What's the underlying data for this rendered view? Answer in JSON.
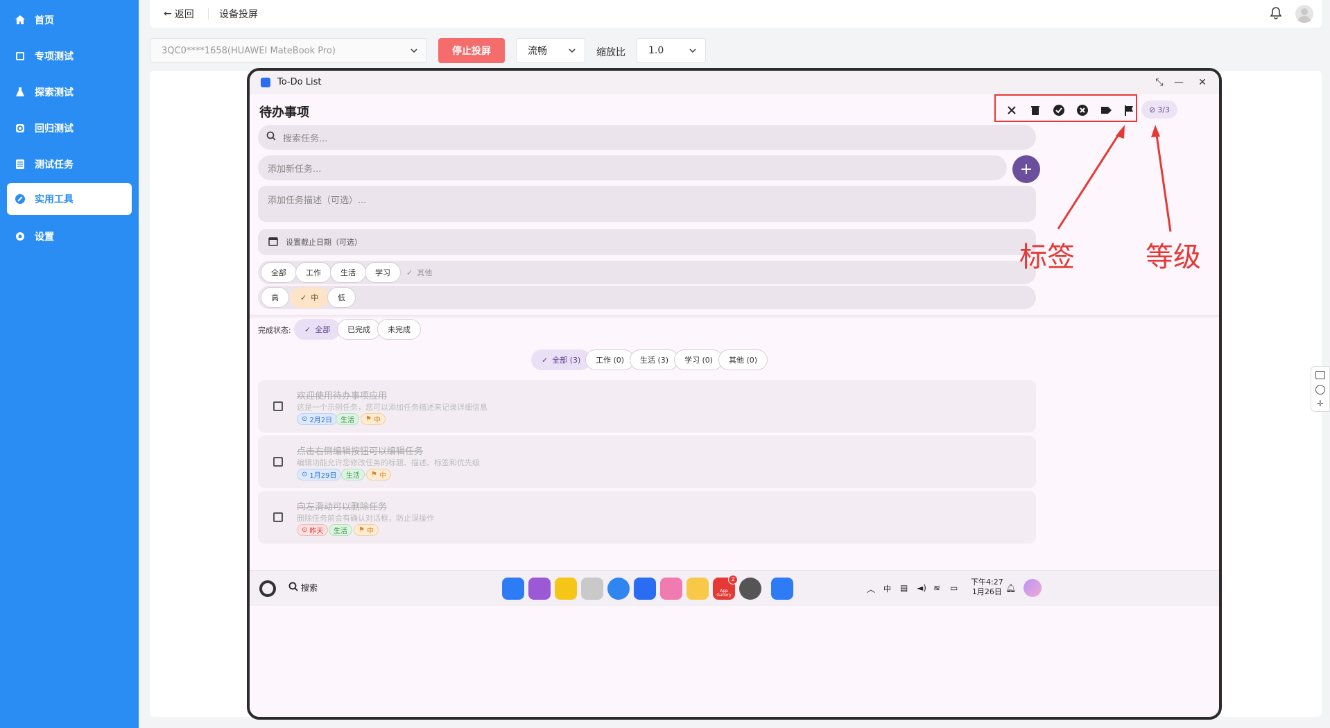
{
  "sidebar": {
    "items": [
      {
        "label": "首页",
        "icon": "home-icon",
        "active": false
      },
      {
        "label": "专项测试",
        "icon": "tablet-icon",
        "active": false
      },
      {
        "label": "探索测试",
        "icon": "flask-icon",
        "active": false
      },
      {
        "label": "回归测试",
        "icon": "refresh-icon",
        "active": false
      },
      {
        "label": "测试任务",
        "icon": "list-icon",
        "active": false
      },
      {
        "label": "实用工具",
        "icon": "wrench-icon",
        "active": true
      },
      {
        "label": "设置",
        "icon": "gear-icon",
        "active": false
      }
    ]
  },
  "topbar": {
    "back_label": "返回",
    "title": "设备投屏"
  },
  "controls": {
    "device_value": "3QC0****1658(HUAWEI MateBook Pro)",
    "stop_label": "停止投屏",
    "fluency_value": "流畅",
    "scale_label": "缩放比",
    "scale_value": "1.0"
  },
  "device_screen": {
    "window_title": "To-Do List",
    "app_title": "待办事项",
    "count_badge": "3/3",
    "search_placeholder": "搜索任务...",
    "add_task_placeholder": "添加新任务...",
    "add_desc_placeholder": "添加任务描述（可选）...",
    "due_date_placeholder": "设置截止日期（可选）",
    "category_chips": [
      "全部",
      "工作",
      "生活",
      "学习",
      "其他"
    ],
    "priority_chips": [
      "高",
      "中",
      "低"
    ],
    "status_label": "完成状态:",
    "status_chips": [
      "全部",
      "已完成",
      "未完成"
    ],
    "filter_chips": [
      "全部 (3)",
      "工作 (0)",
      "生活 (3)",
      "学习 (0)",
      "其他 (0)"
    ],
    "tasks": [
      {
        "title": "欢迎使用待办事项应用",
        "desc": "这是一个示例任务，您可以添加任务描述来记录详细信息",
        "date": "2月2日",
        "category": "生活",
        "priority": "中"
      },
      {
        "title": "点击右侧编辑按钮可以编辑任务",
        "desc": "编辑功能允许您修改任务的标题、描述、标签和优先级",
        "date": "1月29日",
        "category": "生活",
        "priority": "中"
      },
      {
        "title": "向左滑动可以删除任务",
        "desc": "删除任务前会有确认对话框，防止误操作",
        "date": "昨天",
        "category": "生活",
        "priority": "中"
      }
    ],
    "taskbar": {
      "search_label": "搜索",
      "time": "下午4:27",
      "date": "1月26日",
      "appgallery_badge": "2",
      "appgallery_label": "App Gallery",
      "ime_label": "中"
    }
  },
  "annotations": {
    "tag_label": "标签",
    "level_label": "等级"
  },
  "colors": {
    "sidebar": "#2a8df4",
    "stop_button": "#f56c6c",
    "annotation": "#e53935",
    "accent": "#6b4e9c"
  }
}
